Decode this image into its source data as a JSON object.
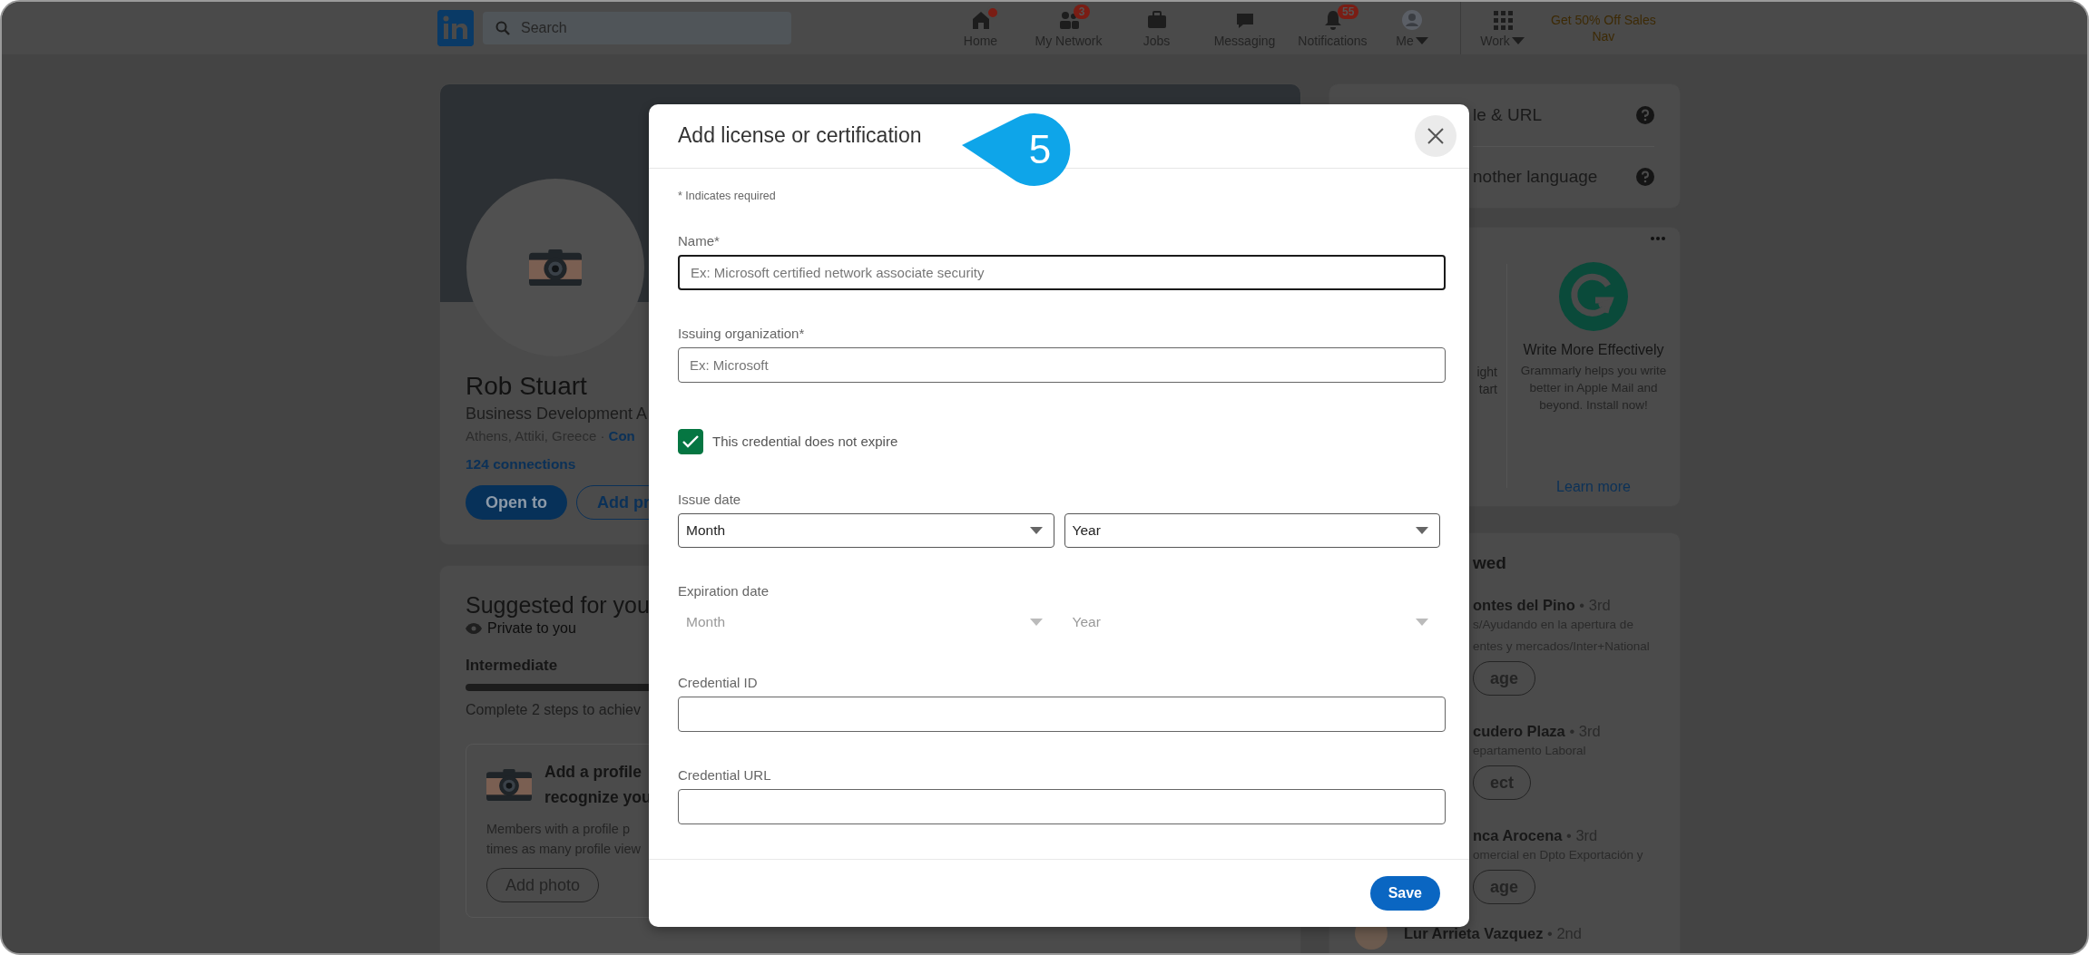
{
  "nav": {
    "search": {
      "placeholder": "Search"
    },
    "items": [
      {
        "label": "Home",
        "dot": true,
        "dropdown": false
      },
      {
        "label": "My Network",
        "badge": "3",
        "dot": false,
        "dropdown": false
      },
      {
        "label": "Jobs",
        "dot": false,
        "dropdown": false
      },
      {
        "label": "Messaging",
        "dot": false,
        "dropdown": false
      },
      {
        "label": "Notifications",
        "badge": "55",
        "dot": false,
        "dropdown": false
      },
      {
        "label": "Me",
        "dot": false,
        "dropdown": true
      },
      {
        "label": "Work",
        "dot": false,
        "dropdown": true
      }
    ],
    "promo": [
      "Get 50% Off Sales",
      "Nav"
    ]
  },
  "profile_card": {
    "name": "Rob Stuart",
    "headline": "Business Development A",
    "location": "Athens, Attiki, Greece · ",
    "contact_link": "Con",
    "connections": "124 connections",
    "buttons": [
      {
        "label": "Open to",
        "kind": "primary"
      },
      {
        "label": "Add pr",
        "kind": "secondary"
      }
    ]
  },
  "suggested": {
    "title": "Suggested for you",
    "privacy": "Private to you",
    "level_name": "Intermediate",
    "level": 0.66,
    "hint": "Complete 2 steps to achiev",
    "tip": {
      "title_lines": [
        "Add a profile",
        "recognize you"
      ],
      "body_lines": [
        "Members with a profile p",
        "times as many profile view"
      ],
      "button": "Add photo"
    }
  },
  "settings_card": {
    "items": [
      {
        "label": "le & URL"
      },
      {
        "label": "nother language"
      }
    ]
  },
  "ad_card": {
    "left_lines": [
      "ight",
      "tart"
    ],
    "title": "Write More Effectively",
    "body": "Grammarly helps you write better in Apple Mail and beyond. Install now!",
    "link": "Learn more"
  },
  "people_card": {
    "title": "wed",
    "people": [
      {
        "name": "ontes del Pino",
        "separator": "•",
        "degree": "3rd",
        "lines": [
          "s/Ayudando en la apertura de",
          "entes y mercados/Inter+National"
        ],
        "button": "age"
      },
      {
        "name": "cudero Plaza",
        "separator": "•",
        "degree": "3rd",
        "lines": [
          "epartamento Laboral"
        ],
        "button": "ect"
      },
      {
        "name": "nca Arocena",
        "separator": "•",
        "degree": "3rd",
        "lines": [
          "omercial en Dpto Exportación y"
        ],
        "button": "age"
      },
      {
        "name": "Lur Arrieta Vazquez",
        "separator": "•",
        "degree": "2nd",
        "photo": true
      }
    ]
  },
  "modal": {
    "title": "Add license or certification",
    "required_note": "* Indicates required",
    "fields": [
      {
        "kind": "text",
        "label": "Name*",
        "placeholder": "Ex: Microsoft certified network associate security",
        "focused": true
      },
      {
        "kind": "text",
        "label": "Issuing organization*",
        "placeholder": "Ex: Microsoft",
        "focused": false
      },
      {
        "kind": "checkbox",
        "label": "This credential does not expire",
        "checked": true
      },
      {
        "kind": "date",
        "label": "Issue date",
        "disabled": false,
        "selects": [
          "Month",
          "Year"
        ]
      },
      {
        "kind": "date",
        "label": "Expiration date",
        "disabled": true,
        "selects": [
          "Month",
          "Year"
        ]
      },
      {
        "kind": "text",
        "label": "Credential ID",
        "focused": false
      },
      {
        "kind": "text",
        "label": "Credential URL",
        "focused": false
      }
    ],
    "save": "Save"
  },
  "callout": {
    "number": "5"
  }
}
